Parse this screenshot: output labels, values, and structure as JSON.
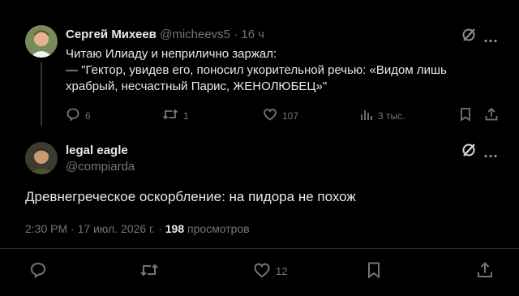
{
  "tweet1": {
    "author_name": "Сергей Михеев",
    "handle": "@micheevs5",
    "separator": "·",
    "time": "16 ч",
    "lines": [
      "Читаю Илиаду и неприлично заржал:",
      "— \"Гектор, увидев его, поносил укорительной речью: «Видом лишь",
      "храбрый, несчастный Парис, ЖЕНОЛЮБЕЦ»\""
    ],
    "replies": "6",
    "retweets": "1",
    "likes": "107",
    "views": "3 тыс."
  },
  "tweet2": {
    "author_name": "legal eagle",
    "handle": "@compiarda",
    "text": "Древнегреческое оскорбление: на пидора не похож",
    "timestamp": "2:30 PM · 17 июл. 2026 г. · ",
    "views_count": "198",
    "views_label": " просмотров",
    "likes": "12"
  },
  "icons": {
    "grok": "grok-slash-icon",
    "more": "more-horizontal-icon",
    "reply": "reply-bubble-icon",
    "retweet": "retweet-icon",
    "like": "heart-icon",
    "views": "analytics-bars-icon",
    "bookmark": "bookmark-icon",
    "share": "share-upload-icon"
  },
  "colors": {
    "background": "#000000",
    "text": "#e7e9ea",
    "muted": "#71767b",
    "divider": "#2f3336"
  }
}
